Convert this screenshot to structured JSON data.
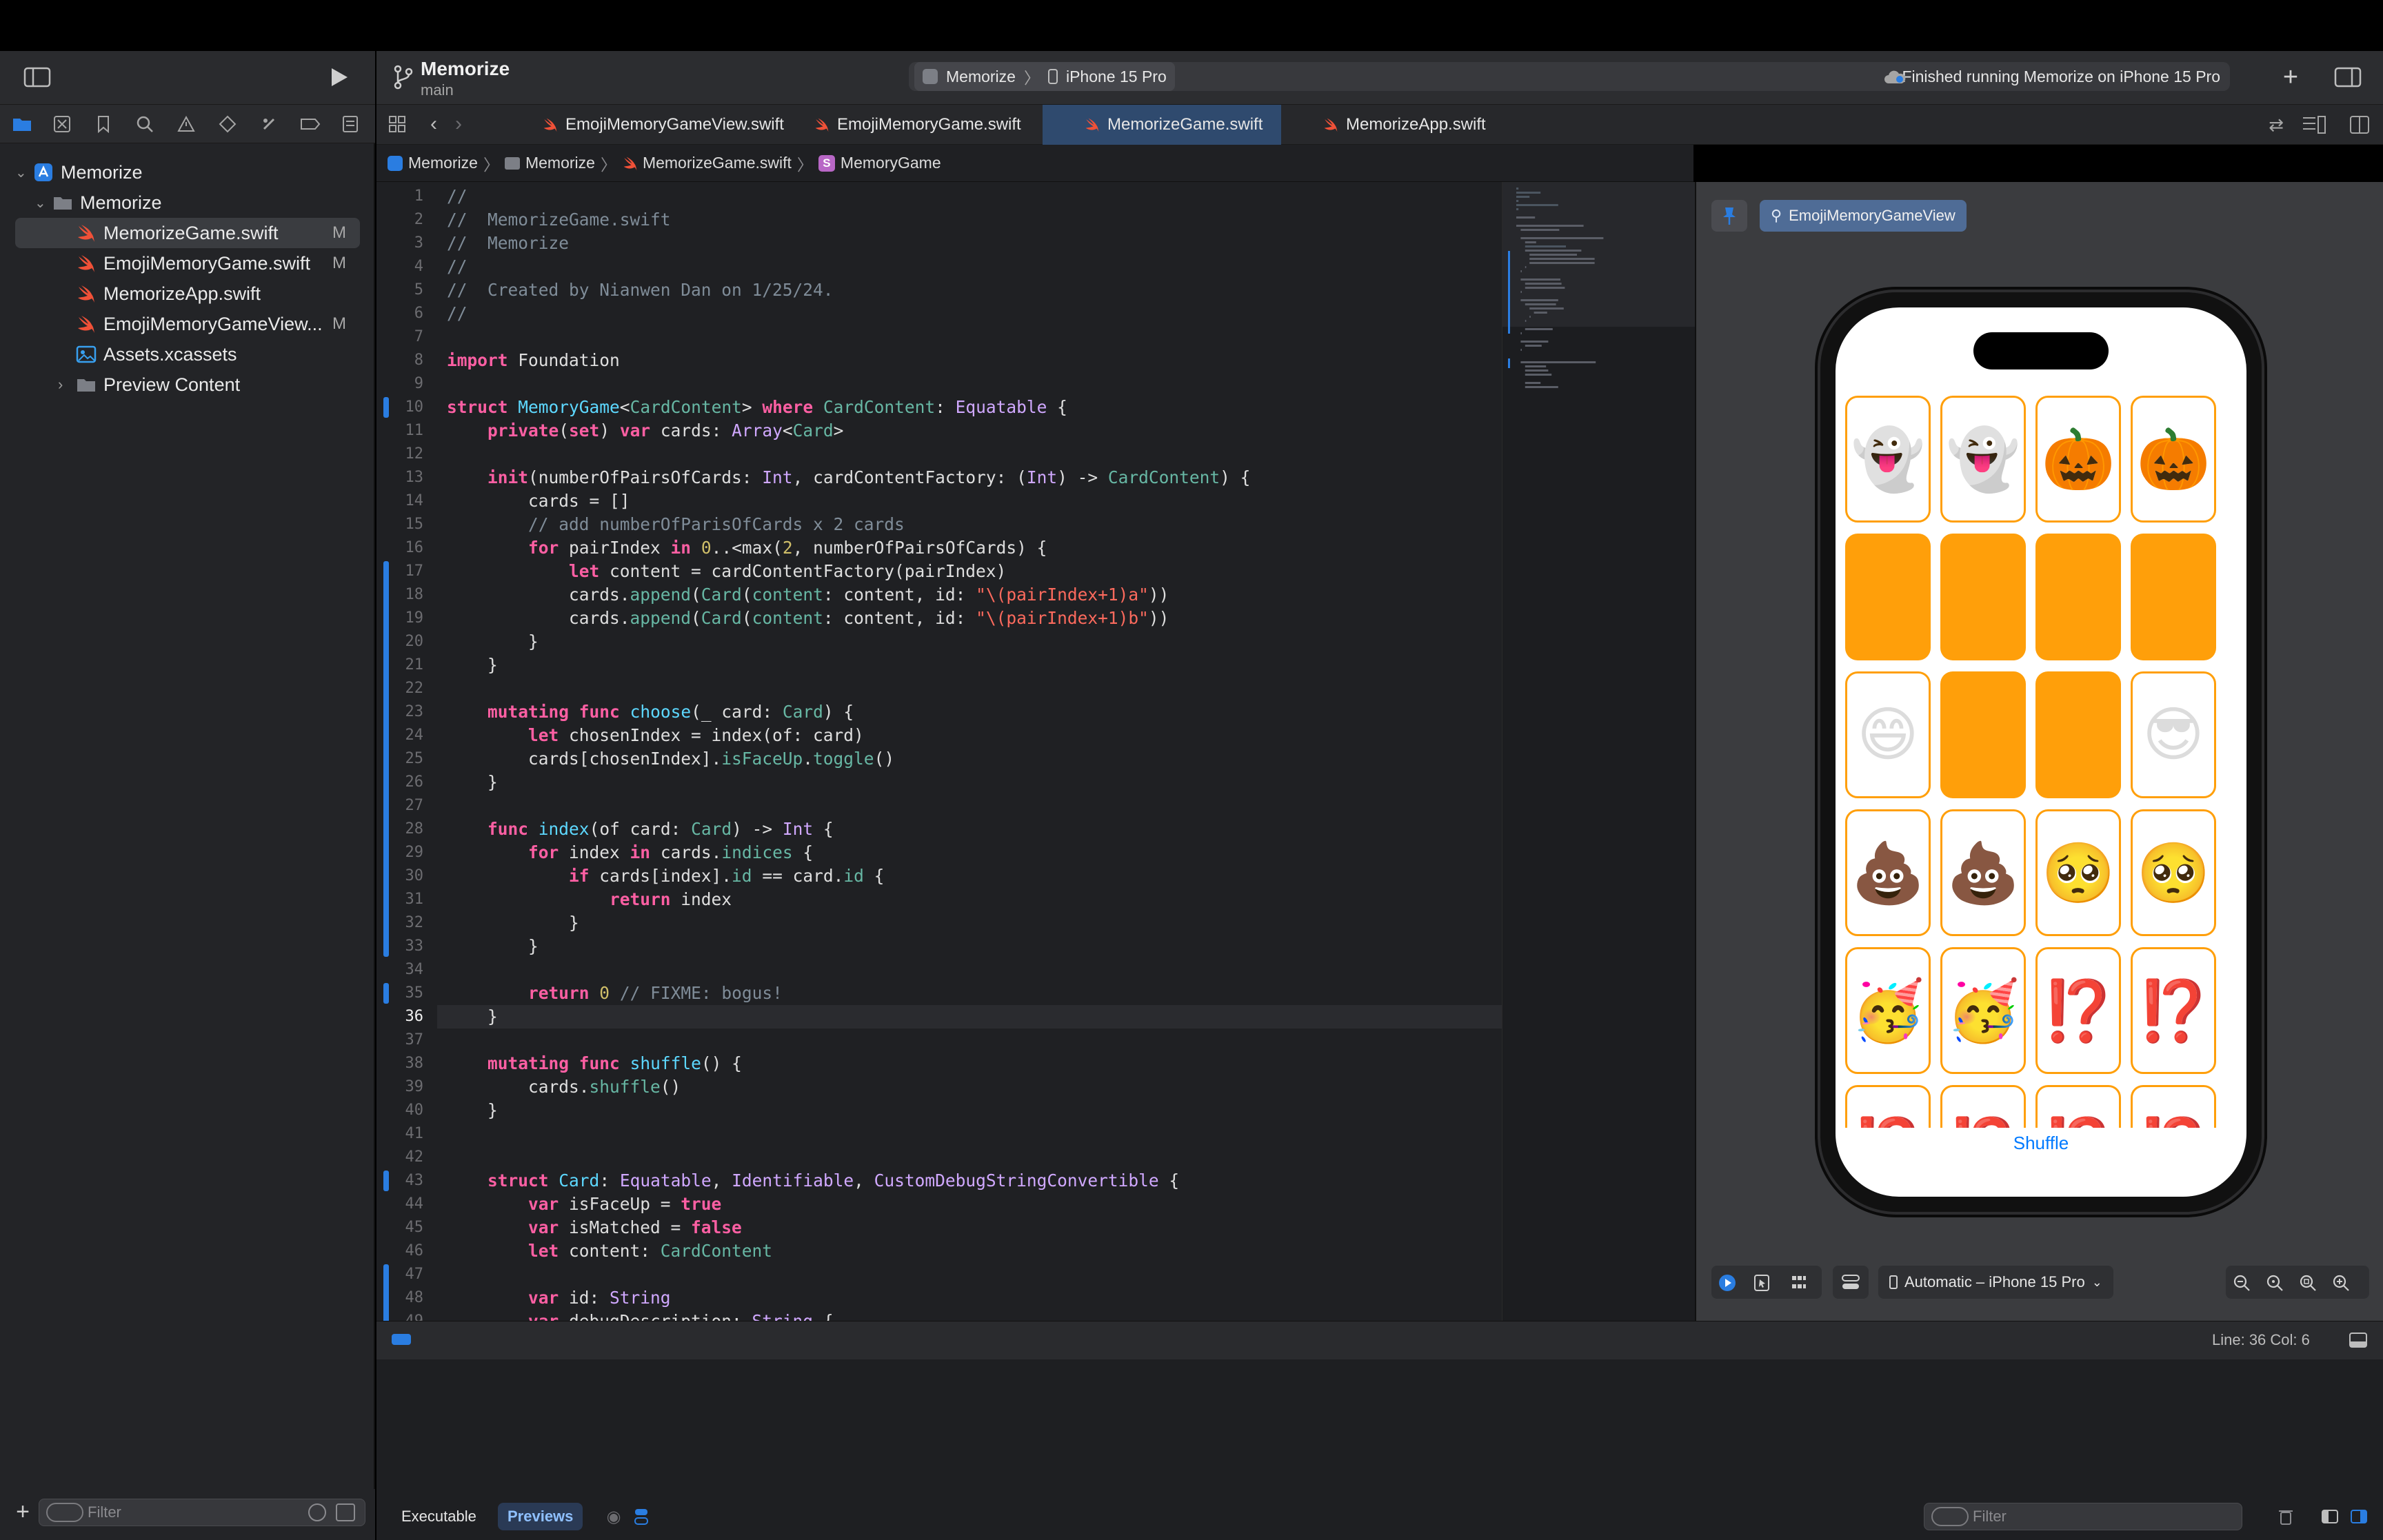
{
  "project": {
    "name": "Memorize",
    "branch": "main"
  },
  "toolbar": {
    "scheme": "Memorize",
    "device": "iPhone 15 Pro",
    "status": "Finished running Memorize on iPhone 15 Pro"
  },
  "tabs": [
    {
      "label": "EmojiMemoryGameView.swift",
      "active": false
    },
    {
      "label": "EmojiMemoryGame.swift",
      "active": false
    },
    {
      "label": "MemorizeGame.swift",
      "active": true
    },
    {
      "label": "MemorizeApp.swift",
      "active": false
    }
  ],
  "breadcrumb": [
    "Memorize",
    "Memorize",
    "MemorizeGame.swift",
    "MemoryGame"
  ],
  "navigator": {
    "root": "Memorize",
    "group": "Memorize",
    "files": [
      {
        "name": "MemorizeGame.swift",
        "badge": "M",
        "selected": true
      },
      {
        "name": "EmojiMemoryGame.swift",
        "badge": "M",
        "selected": false
      },
      {
        "name": "MemorizeApp.swift",
        "badge": "",
        "selected": false
      },
      {
        "name": "EmojiMemoryGameView...",
        "badge": "M",
        "selected": false
      },
      {
        "name": "Assets.xcassets",
        "badge": "",
        "selected": false
      },
      {
        "name": "Preview Content",
        "badge": "",
        "selected": false
      }
    ],
    "filter_placeholder": "Filter"
  },
  "code": {
    "first_line": 1,
    "current_line": 36,
    "lines": [
      "//",
      "//  MemorizeGame.swift",
      "//  Memorize",
      "//",
      "//  Created by Nianwen Dan on 1/25/24.",
      "//",
      "",
      "import Foundation",
      "",
      "struct MemoryGame<CardContent> where CardContent: Equatable {",
      "    private(set) var cards: Array<Card>",
      "",
      "    init(numberOfPairsOfCards: Int, cardContentFactory: (Int) -> CardContent) {",
      "        cards = []",
      "        // add numberOfParisOfCards x 2 cards",
      "        for pairIndex in 0..<max(2, numberOfPairsOfCards) {",
      "            let content = cardContentFactory(pairIndex)",
      "            cards.append(Card(content: content, id: \"\\(pairIndex+1)a\"))",
      "            cards.append(Card(content: content, id: \"\\(pairIndex+1)b\"))",
      "        }",
      "    }",
      "",
      "    mutating func choose(_ card: Card) {",
      "        let chosenIndex = index(of: card)",
      "        cards[chosenIndex].isFaceUp.toggle()",
      "    }",
      "",
      "    func index(of card: Card) -> Int {",
      "        for index in cards.indices {",
      "            if cards[index].id == card.id {",
      "                return index",
      "            }",
      "        }",
      "",
      "        return 0 // FIXME: bogus!",
      "    }",
      "",
      "    mutating func shuffle() {",
      "        cards.shuffle()",
      "    }",
      "",
      "",
      "    struct Card: Equatable, Identifiable, CustomDebugStringConvertible {",
      "        var isFaceUp = true",
      "        var isMatched = false",
      "        let content: CardContent",
      "",
      "        var id: String",
      "        var debugDescription: String {"
    ]
  },
  "preview": {
    "view_name": "EmojiMemoryGameView",
    "device_selector": "Automatic – iPhone 15 Pro",
    "shuffle_label": "Shuffle",
    "cards": [
      {
        "face_up": true,
        "emoji": "👻"
      },
      {
        "face_up": true,
        "emoji": "👻"
      },
      {
        "face_up": true,
        "emoji": "🎃"
      },
      {
        "face_up": true,
        "emoji": "🎃"
      },
      {
        "face_up": false,
        "emoji": ""
      },
      {
        "face_up": false,
        "emoji": ""
      },
      {
        "face_up": false,
        "emoji": ""
      },
      {
        "face_up": false,
        "emoji": ""
      },
      {
        "face_up": true,
        "emoji": "😄"
      },
      {
        "face_up": false,
        "emoji": ""
      },
      {
        "face_up": false,
        "emoji": ""
      },
      {
        "face_up": true,
        "emoji": "😎"
      },
      {
        "face_up": true,
        "emoji": "💩"
      },
      {
        "face_up": true,
        "emoji": "💩"
      },
      {
        "face_up": true,
        "emoji": "🥺"
      },
      {
        "face_up": true,
        "emoji": "🥺"
      },
      {
        "face_up": true,
        "emoji": "🥳"
      },
      {
        "face_up": true,
        "emoji": "🥳"
      },
      {
        "face_up": true,
        "emoji": "⁉️"
      },
      {
        "face_up": true,
        "emoji": "⁉️"
      },
      {
        "face_up": true,
        "emoji": "⁉️"
      },
      {
        "face_up": true,
        "emoji": "⁉️"
      },
      {
        "face_up": true,
        "emoji": "⁉️"
      },
      {
        "face_up": true,
        "emoji": "⁉️"
      }
    ]
  },
  "status": {
    "position": "Line: 36  Col: 6"
  },
  "debug": {
    "executable_label": "Executable",
    "previews_label": "Previews",
    "filter_placeholder": "Filter"
  },
  "colors": {
    "accent": "#2a7de1",
    "card_orange": "#ff9f0a",
    "editor_bg": "#1f2023",
    "keyword": "#fc5fa3"
  }
}
